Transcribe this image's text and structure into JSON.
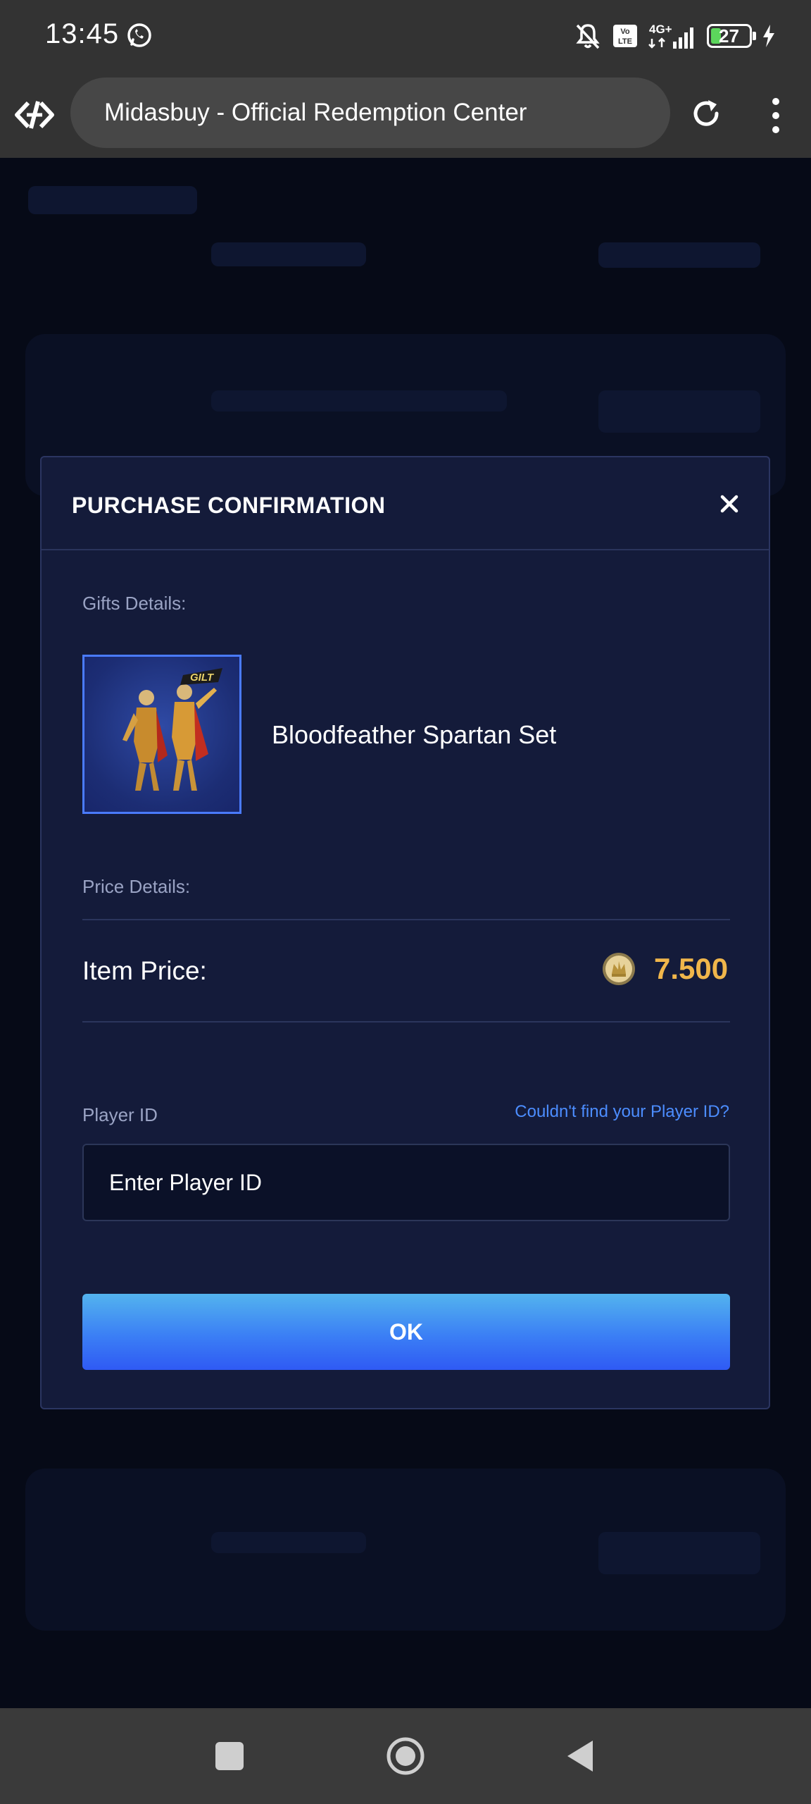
{
  "status_bar": {
    "time": "13:45",
    "battery_level": "27",
    "network": "4G+"
  },
  "browser": {
    "url_title": "Midasbuy - Official Redemption Center"
  },
  "modal": {
    "title": "PURCHASE CONFIRMATION",
    "gifts_label": "Gifts Details:",
    "gift_name": "Bloodfeather Spartan Set",
    "gift_badge": "GILT",
    "price_label": "Price Details:",
    "item_price_label": "Item Price:",
    "item_price_value": "7.500",
    "player_id_label": "Player ID",
    "player_id_help": "Couldn't find your Player ID?",
    "player_id_placeholder": "Enter Player ID",
    "ok_label": "OK"
  },
  "colors": {
    "modal_bg": "#141b3a",
    "accent_blue": "#3b7ff5",
    "price_gold": "#f0b64b",
    "link_blue": "#4c8dff"
  },
  "icons": [
    "whatsapp-icon",
    "mute-bell-icon",
    "volte-icon",
    "signal-icon",
    "battery-icon",
    "charging-icon",
    "browser-logo-icon",
    "reload-icon",
    "more-vert-icon",
    "close-icon",
    "uc-coin-icon",
    "recents-icon",
    "home-icon",
    "back-icon"
  ]
}
